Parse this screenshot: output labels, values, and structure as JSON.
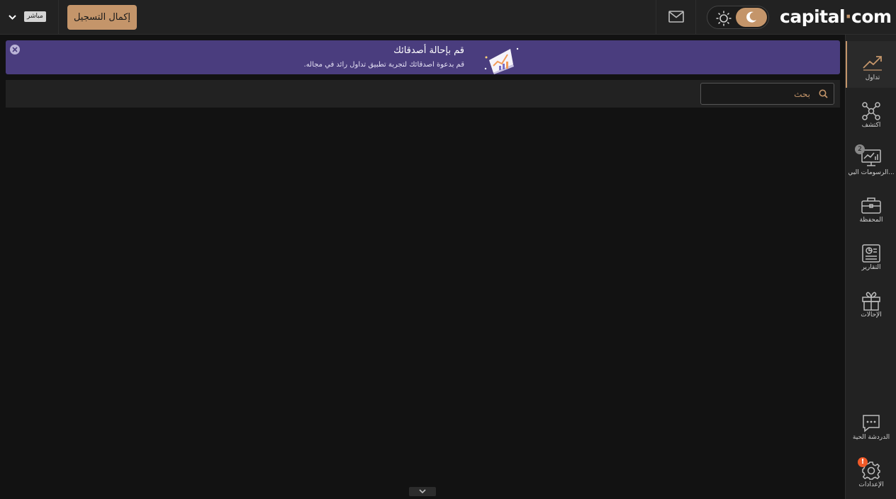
{
  "header": {
    "logo_text": "capital",
    "logo_dot": "·",
    "logo_suffix": "com",
    "live_badge": "مباشر",
    "complete_registration": "إكمال التسجيل",
    "accent_color": "#c4956a"
  },
  "banner": {
    "title": "قم بإحالة أصدقائك",
    "subtitle": "قم بدعوة اصدقائك لتجربة تطبيق تداول رائد في مجاله.",
    "background": "#4a3d7e"
  },
  "search": {
    "placeholder": "بحث"
  },
  "sidebar": {
    "items": [
      {
        "label": "تداول",
        "icon": "trend-up-icon",
        "active": true
      },
      {
        "label": "اكتشف",
        "icon": "network-icon"
      },
      {
        "label": "الرسومات البي...",
        "icon": "monitor-chart-icon",
        "badge": "2"
      },
      {
        "label": "المحفظة",
        "icon": "briefcase-icon"
      },
      {
        "label": "التقارير",
        "icon": "report-icon"
      },
      {
        "label": "الإحالات",
        "icon": "gift-icon"
      },
      {
        "label": "الدردشة الحية",
        "icon": "chat-icon"
      },
      {
        "label": "الإعدادات",
        "icon": "gear-icon",
        "badge": "!"
      }
    ]
  }
}
